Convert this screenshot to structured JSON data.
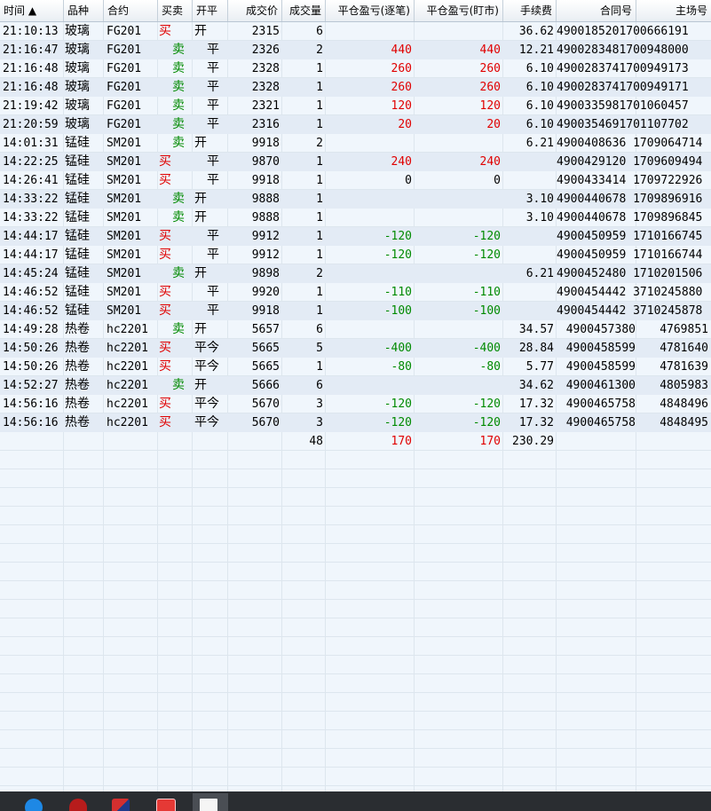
{
  "header": {
    "col_time": "时间 ▲",
    "col_variety": "品种",
    "col_contract": "合约",
    "col_bs": "买卖",
    "col_oc": "开平",
    "col_price": "成交价",
    "col_qty": "成交量",
    "col_pnl_trade": "平仓盈亏(逐笔)",
    "col_pnl_mark": "平仓盈亏(盯市)",
    "col_fee": "手续费",
    "col_contract_no": "合同号",
    "col_main_no": "主场号"
  },
  "rows": [
    {
      "time": "21:10:13",
      "variety": "玻璃",
      "contract": "FG201",
      "bs": "买",
      "oc": "开",
      "price": "2315",
      "qty": "6",
      "pnl1": "",
      "pnl2": "",
      "fee": "36.62",
      "cno": "4900185201700666191",
      "mno": ""
    },
    {
      "time": "21:16:47",
      "variety": "玻璃",
      "contract": "FG201",
      "bs": "卖",
      "oc": "平",
      "price": "2326",
      "qty": "2",
      "pnl1": "440",
      "pnl2": "440",
      "fee": "12.21",
      "cno": "4900283481700948000",
      "mno": ""
    },
    {
      "time": "21:16:48",
      "variety": "玻璃",
      "contract": "FG201",
      "bs": "卖",
      "oc": "平",
      "price": "2328",
      "qty": "1",
      "pnl1": "260",
      "pnl2": "260",
      "fee": "6.10",
      "cno": "4900283741700949173",
      "mno": ""
    },
    {
      "time": "21:16:48",
      "variety": "玻璃",
      "contract": "FG201",
      "bs": "卖",
      "oc": "平",
      "price": "2328",
      "qty": "1",
      "pnl1": "260",
      "pnl2": "260",
      "fee": "6.10",
      "cno": "4900283741700949171",
      "mno": ""
    },
    {
      "time": "21:19:42",
      "variety": "玻璃",
      "contract": "FG201",
      "bs": "卖",
      "oc": "平",
      "price": "2321",
      "qty": "1",
      "pnl1": "120",
      "pnl2": "120",
      "fee": "6.10",
      "cno": "4900335981701060457",
      "mno": ""
    },
    {
      "time": "21:20:59",
      "variety": "玻璃",
      "contract": "FG201",
      "bs": "卖",
      "oc": "平",
      "price": "2316",
      "qty": "1",
      "pnl1": "20",
      "pnl2": "20",
      "fee": "6.10",
      "cno": "4900354691701107702",
      "mno": ""
    },
    {
      "time": "14:01:31",
      "variety": "锰硅",
      "contract": "SM201",
      "bs": "卖",
      "oc": "开",
      "price": "9918",
      "qty": "2",
      "pnl1": "",
      "pnl2": "",
      "fee": "6.21",
      "cno": "4900408636 1709064714",
      "mno": ""
    },
    {
      "time": "14:22:25",
      "variety": "锰硅",
      "contract": "SM201",
      "bs": "买",
      "oc": "平",
      "price": "9870",
      "qty": "1",
      "pnl1": "240",
      "pnl2": "240",
      "fee": "",
      "cno": "4900429120 1709609494",
      "mno": ""
    },
    {
      "time": "14:26:41",
      "variety": "锰硅",
      "contract": "SM201",
      "bs": "买",
      "oc": "平",
      "price": "9918",
      "qty": "1",
      "pnl1": "0",
      "pnl2": "0",
      "fee": "",
      "cno": "4900433414 1709722926",
      "mno": ""
    },
    {
      "time": "14:33:22",
      "variety": "锰硅",
      "contract": "SM201",
      "bs": "卖",
      "oc": "开",
      "price": "9888",
      "qty": "1",
      "pnl1": "",
      "pnl2": "",
      "fee": "3.10",
      "cno": "4900440678 1709896916",
      "mno": ""
    },
    {
      "time": "14:33:22",
      "variety": "锰硅",
      "contract": "SM201",
      "bs": "卖",
      "oc": "开",
      "price": "9888",
      "qty": "1",
      "pnl1": "",
      "pnl2": "",
      "fee": "3.10",
      "cno": "4900440678 1709896845",
      "mno": ""
    },
    {
      "time": "14:44:17",
      "variety": "锰硅",
      "contract": "SM201",
      "bs": "买",
      "oc": "平",
      "price": "9912",
      "qty": "1",
      "pnl1": "-120",
      "pnl2": "-120",
      "fee": "",
      "cno": "4900450959 1710166745",
      "mno": ""
    },
    {
      "time": "14:44:17",
      "variety": "锰硅",
      "contract": "SM201",
      "bs": "买",
      "oc": "平",
      "price": "9912",
      "qty": "1",
      "pnl1": "-120",
      "pnl2": "-120",
      "fee": "",
      "cno": "4900450959 1710166744",
      "mno": ""
    },
    {
      "time": "14:45:24",
      "variety": "锰硅",
      "contract": "SM201",
      "bs": "卖",
      "oc": "开",
      "price": "9898",
      "qty": "2",
      "pnl1": "",
      "pnl2": "",
      "fee": "6.21",
      "cno": "4900452480 1710201506",
      "mno": ""
    },
    {
      "time": "14:46:52",
      "variety": "锰硅",
      "contract": "SM201",
      "bs": "买",
      "oc": "平",
      "price": "9920",
      "qty": "1",
      "pnl1": "-110",
      "pnl2": "-110",
      "fee": "",
      "cno": "4900454442 3710245880",
      "mno": ""
    },
    {
      "time": "14:46:52",
      "variety": "锰硅",
      "contract": "SM201",
      "bs": "买",
      "oc": "平",
      "price": "9918",
      "qty": "1",
      "pnl1": "-100",
      "pnl2": "-100",
      "fee": "",
      "cno": "4900454442 3710245878",
      "mno": ""
    },
    {
      "time": "14:49:28",
      "variety": "热卷",
      "contract": "hc2201",
      "bs": "卖",
      "oc": "开",
      "price": "5657",
      "qty": "6",
      "pnl1": "",
      "pnl2": "",
      "fee": "34.57",
      "cno": "4900457380",
      "mno": "4769851"
    },
    {
      "time": "14:50:26",
      "variety": "热卷",
      "contract": "hc2201",
      "bs": "买",
      "oc": "平今",
      "price": "5665",
      "qty": "5",
      "pnl1": "-400",
      "pnl2": "-400",
      "fee": "28.84",
      "cno": "4900458599",
      "mno": "4781640"
    },
    {
      "time": "14:50:26",
      "variety": "热卷",
      "contract": "hc2201",
      "bs": "买",
      "oc": "平今",
      "price": "5665",
      "qty": "1",
      "pnl1": "-80",
      "pnl2": "-80",
      "fee": "5.77",
      "cno": "4900458599",
      "mno": "4781639"
    },
    {
      "time": "14:52:27",
      "variety": "热卷",
      "contract": "hc2201",
      "bs": "卖",
      "oc": "开",
      "price": "5666",
      "qty": "6",
      "pnl1": "",
      "pnl2": "",
      "fee": "34.62",
      "cno": "4900461300",
      "mno": "4805983"
    },
    {
      "time": "14:56:16",
      "variety": "热卷",
      "contract": "hc2201",
      "bs": "买",
      "oc": "平今",
      "price": "5670",
      "qty": "3",
      "pnl1": "-120",
      "pnl2": "-120",
      "fee": "17.32",
      "cno": "4900465758",
      "mno": "4848496"
    },
    {
      "time": "14:56:16",
      "variety": "热卷",
      "contract": "hc2201",
      "bs": "买",
      "oc": "平今",
      "price": "5670",
      "qty": "3",
      "pnl1": "-120",
      "pnl2": "-120",
      "fee": "17.32",
      "cno": "4900465758",
      "mno": "4848495"
    }
  ],
  "totals": {
    "qty": "48",
    "pnl1": "170",
    "pnl2": "170",
    "fee": "230.29"
  },
  "colors": {
    "buy": "#e00000",
    "sell": "#008a00",
    "profit": "#e00000",
    "loss": "#008a00"
  },
  "taskbar": {
    "items": [
      "app-icon-1",
      "app-icon-2",
      "app-icon-3",
      "app-icon-4",
      "app-icon-5",
      "document-icon"
    ]
  }
}
